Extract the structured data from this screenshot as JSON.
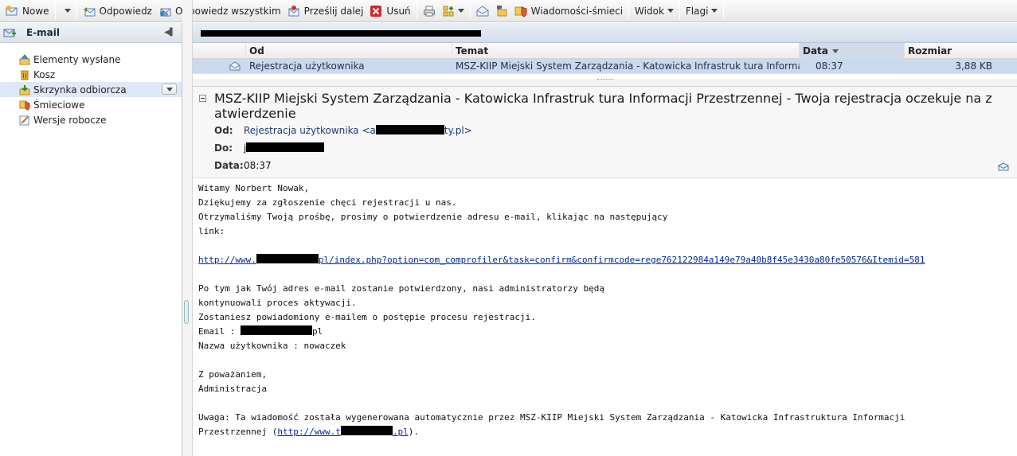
{
  "toolbar": {
    "new_label": "Nowe",
    "reply_label": "Odpowiedz",
    "reply_all_label": "Odpowiedz wszystkim",
    "forward_label": "Prześlij dalej",
    "delete_label": "Usuń",
    "spam_label": "Wiadomości-śmieci",
    "view_label": "Widok",
    "flags_label": "Flagi"
  },
  "sidebar": {
    "title": "E-mail",
    "folders": [
      {
        "label": "Elementy wysłane"
      },
      {
        "label": "Kosz"
      },
      {
        "label": "Skrzynka odbiorcza"
      },
      {
        "label": "Śmieciowe"
      },
      {
        "label": "Wersje robocze"
      }
    ]
  },
  "list": {
    "columns": {
      "from": "Od",
      "subject": "Temat",
      "date": "Data",
      "size": "Rozmiar"
    },
    "rows": [
      {
        "from": "Rejestracja użytkownika",
        "subject": "MSZ-KIIP Miejski System Zarządzania - Katowicka Infrastruk tura Informacji Prz...",
        "date": "08:37",
        "size": "3,88 KB"
      }
    ]
  },
  "preview": {
    "subject": "MSZ-KIIP Miejski System Zarządzania - Katowicka Infrastruk tura Informacji Przestrzennej - Twoja rejestracja oczekuje na z atwierdzenie",
    "from_label": "Od:",
    "from_name": "Rejestracja użytkownika <a",
    "from_tail": "ty.pl>",
    "to_label": "Do:",
    "to_value": "j",
    "date_label": "Data:",
    "date_value": "08:37"
  },
  "body": {
    "l1": "Witamy Norbert Nowak,",
    "l2": "Dziękujemy za zgłoszenie chęci rejestracji u nas.",
    "l3": "Otrzymaliśmy Twoją prośbę, prosimy o potwierdzenie adresu e-mail, klikając na następujący",
    "l4": "link:",
    "link_start": "http://www.",
    "link_end": "pl/index.php?option=com_comprofiler&task=confirm&confirmcode=rege762122984a149e79a40b8f45e3430a80fe50576&Itemid=581",
    "l6": "Po tym jak Twój adres e-mail zostanie potwierdzony, nasi administratorzy będą",
    "l7": "kontynuowali proces aktywacji.",
    "l8": "Zostaniesz powiadomiony e-mailem o postępie procesu rejestracji.",
    "email_label": "Email : ",
    "email_tail": "pl",
    "username_line": "Nazwa użytkownika : nowaczek",
    "regards": "Z poważaniem,",
    "signature": "Administracja",
    "note1": "Uwaga: Ta wiadomość została wygenerowana automatycznie przez MSZ-KIIP Miejski System Zarządzania - Katowicka Infrastruktura Informacji",
    "note2_start": "Przestrzennej (",
    "note2_link_start": "http://www.t",
    "note2_link_end": ".pl",
    "note2_end": ")."
  }
}
